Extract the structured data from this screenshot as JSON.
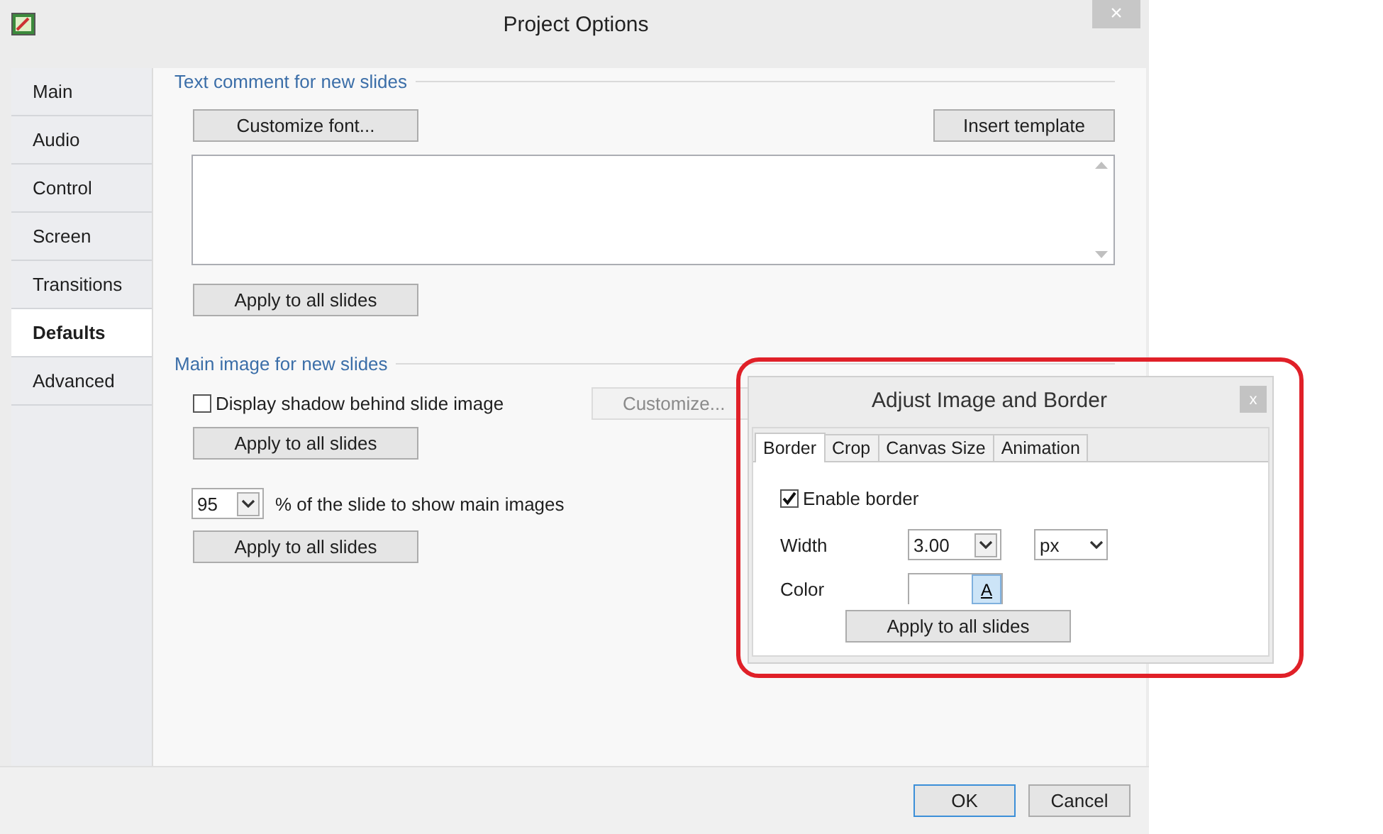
{
  "window": {
    "title": "Project Options",
    "close": "×"
  },
  "sidebar": {
    "items": [
      {
        "label": "Main",
        "selected": false
      },
      {
        "label": "Audio",
        "selected": false
      },
      {
        "label": "Control",
        "selected": false
      },
      {
        "label": "Screen",
        "selected": false
      },
      {
        "label": "Transitions",
        "selected": false
      },
      {
        "label": "Defaults",
        "selected": true
      },
      {
        "label": "Advanced",
        "selected": false
      }
    ]
  },
  "text_comment": {
    "heading": "Text comment for new slides",
    "customize_button": "Customize font...",
    "insert_button": "Insert template",
    "apply_button": "Apply to all slides"
  },
  "main_image": {
    "heading": "Main image for new slides",
    "shadow": {
      "label": "Display shadow behind slide image",
      "checked": false
    },
    "customize_button": {
      "label": "Customize...",
      "disabled": true
    },
    "apply_button": "Apply to all slides",
    "percent": {
      "value": "95",
      "label": "% of the slide to show main images"
    },
    "apply_button_2": "Apply to all slides"
  },
  "dialog": {
    "title": "Adjust Image and Border",
    "close": "x",
    "tabs": [
      {
        "label": "Border",
        "selected": true
      },
      {
        "label": "Crop",
        "selected": false
      },
      {
        "label": "Canvas Size",
        "selected": false
      },
      {
        "label": "Animation",
        "selected": false
      }
    ],
    "enable_border": {
      "label": "Enable border",
      "checked": true
    },
    "width": {
      "label": "Width",
      "value": "3.00",
      "unit": "px"
    },
    "color": {
      "label": "Color",
      "button": "A"
    },
    "apply_button": "Apply to all slides"
  },
  "footer": {
    "buttons": [
      {
        "label": "OK",
        "default": true
      },
      {
        "label": "Cancel",
        "default": false
      }
    ]
  }
}
